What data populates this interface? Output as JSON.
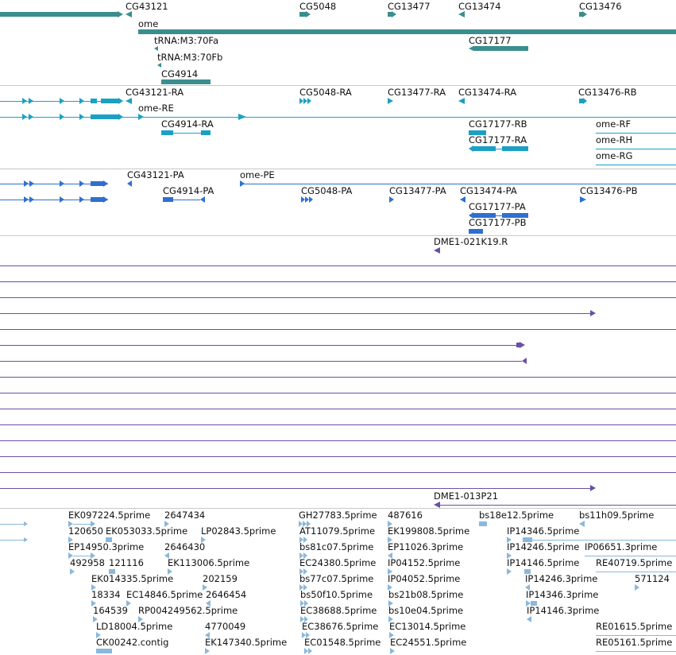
{
  "colors": {
    "gene": "#3a8e8e",
    "transcript": "#1ba0c4",
    "protein": "#2f6fd0",
    "clone": "#6b4ea6",
    "est": "#8ab8dc",
    "divider": "#c8c8c8"
  },
  "genes": {
    "cg43121": "CG43121",
    "cg5048": "CG5048",
    "cg13477": "CG13477",
    "cg13474": "CG13474",
    "cg13476": "CG13476",
    "ome": "ome",
    "trna_a": "tRNA:M3:70Fa",
    "trna_b": "tRNA:M3:70Fb",
    "cg17177": "CG17177",
    "cg4914": "CG4914"
  },
  "transcripts": {
    "cg43121_ra": "CG43121-RA",
    "cg5048_ra": "CG5048-RA",
    "cg13477_ra": "CG13477-RA",
    "cg13474_ra": "CG13474-RA",
    "cg13476_rb": "CG13476-RB",
    "ome_re": "ome-RE",
    "cg4914_ra": "CG4914-RA",
    "cg17177_rb": "CG17177-RB",
    "cg17177_ra": "CG17177-RA",
    "ome_rf": "ome-RF",
    "ome_rh": "ome-RH",
    "ome_rg": "ome-RG"
  },
  "proteins": {
    "cg43121_pa": "CG43121-PA",
    "ome_pe": "ome-PE",
    "cg4914_pa": "CG4914-PA",
    "cg5048_pa": "CG5048-PA",
    "cg13477_pa": "CG13477-PA",
    "cg13474_pa": "CG13474-PA",
    "cg13476_pb": "CG13476-PB",
    "cg17177_pa": "CG17177-PA",
    "cg17177_pb": "CG17177-PB"
  },
  "clones": {
    "top": "DME1-021K19.R",
    "bottom": "DME1-013P21"
  },
  "ests": [
    "EK097224.5prime",
    "2647434",
    "GH27783.5prime",
    "487616",
    "bs18e12.5prime",
    "bs11h09.5prime",
    "120650",
    "EK053033.5prime",
    "LP02843.5prime",
    "AT11079.5prime",
    "EK199808.5prime",
    "IP14346.5prime",
    "EP14950.3prime",
    "2646430",
    "bs81c07.5prime",
    "EP11026.3prime",
    "IP14246.5prime",
    "IP06651.3prime",
    "492958",
    "121116",
    "EK113006.5prime",
    "EC24380.5prime",
    "IP04152.5prime",
    "IP14146.5prime",
    "RE40719.5prime",
    "EK014335.5prime",
    "202159",
    "bs77c07.5prime",
    "IP04052.5prime",
    "IP14246.3prime",
    "571124",
    "18334",
    "EC14846.5prime",
    "2646454",
    "bs50f10.5prime",
    "bs21b08.5prime",
    "IP14346.3prime",
    "164539",
    "RP004249562.5prime",
    "EC38688.5prime",
    "bs10e04.5prime",
    "IP14146.3prime",
    "LD18004.5prime",
    "4770049",
    "EC38676.5prime",
    "EC13014.5prime",
    "RE01615.5prime",
    "CK00242.contig",
    "EK147340.5prime",
    "EC01548.5prime",
    "EC24551.5prime",
    "RE05161.5prime"
  ]
}
